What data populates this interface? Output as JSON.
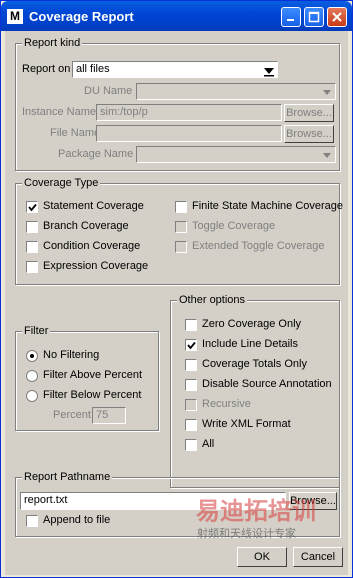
{
  "window": {
    "title": "Coverage Report",
    "icon_letter": "M"
  },
  "report_kind": {
    "legend": "Report kind",
    "report_on_label": "Report on",
    "report_on_value": "all files",
    "du_name_label": "DU Name",
    "du_name_value": "",
    "instance_name_label": "Instance Name",
    "instance_name_value": "sim:/top/p",
    "file_name_label": "File Name",
    "file_name_value": "",
    "package_name_label": "Package Name",
    "package_name_value": "",
    "browse_label": "Browse..."
  },
  "coverage_type": {
    "legend": "Coverage Type",
    "items": [
      {
        "label": "Statement Coverage",
        "checked": true,
        "enabled": true
      },
      {
        "label": "Branch Coverage",
        "checked": false,
        "enabled": true
      },
      {
        "label": "Condition Coverage",
        "checked": false,
        "enabled": true
      },
      {
        "label": "Expression Coverage",
        "checked": false,
        "enabled": true
      },
      {
        "label": "Finite State Machine Coverage",
        "checked": false,
        "enabled": true
      },
      {
        "label": "Toggle Coverage",
        "checked": false,
        "enabled": false
      },
      {
        "label": "Extended Toggle Coverage",
        "checked": false,
        "enabled": false
      }
    ]
  },
  "filter": {
    "legend": "Filter",
    "options": [
      "No Filtering",
      "Filter Above Percent",
      "Filter Below Percent"
    ],
    "selected": "No Filtering",
    "percent_label": "Percent",
    "percent_value": "75"
  },
  "other_options": {
    "legend": "Other options",
    "items": [
      {
        "label": "Zero Coverage Only",
        "checked": false,
        "enabled": true
      },
      {
        "label": "Include Line Details",
        "checked": true,
        "enabled": true
      },
      {
        "label": "Coverage Totals Only",
        "checked": false,
        "enabled": true
      },
      {
        "label": "Disable Source Annotation",
        "checked": false,
        "enabled": true
      },
      {
        "label": "Recursive",
        "checked": false,
        "enabled": false
      },
      {
        "label": "Write XML Format",
        "checked": false,
        "enabled": true
      },
      {
        "label": "All",
        "checked": false,
        "enabled": true
      }
    ]
  },
  "report_pathname": {
    "legend": "Report Pathname",
    "value": "report.txt",
    "browse_label": "Browse...",
    "append_label": "Append to file",
    "append_checked": false
  },
  "buttons": {
    "ok": "OK",
    "cancel": "Cancel"
  },
  "watermark": {
    "line1": "易迪拓培训",
    "line2": "射频和天线设计专家"
  },
  "colors": {
    "title_bar": "#0a5fe0",
    "dialog_bg": "#d4d0c8",
    "disabled_text": "#808080"
  }
}
